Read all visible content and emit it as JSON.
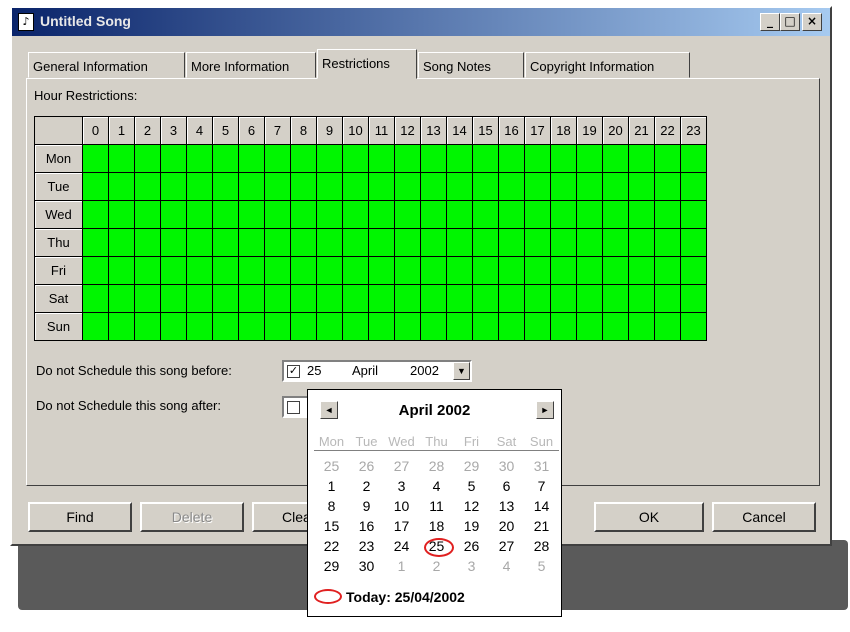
{
  "window": {
    "title": "Untitled Song",
    "controls": {
      "minimize": "_",
      "maximize": "□",
      "close": "×"
    }
  },
  "tabs": [
    {
      "label": "General Information"
    },
    {
      "label": "More Information"
    },
    {
      "label": "Restrictions",
      "active": true
    },
    {
      "label": "Song Notes"
    },
    {
      "label": "Copyright Information"
    }
  ],
  "restrictions": {
    "hour_label": "Hour Restrictions:",
    "hours": [
      "0",
      "1",
      "2",
      "3",
      "4",
      "5",
      "6",
      "7",
      "8",
      "9",
      "10",
      "11",
      "12",
      "13",
      "14",
      "15",
      "16",
      "17",
      "18",
      "19",
      "20",
      "21",
      "22",
      "23"
    ],
    "days": [
      "Mon",
      "Tue",
      "Wed",
      "Thu",
      "Fri",
      "Sat",
      "Sun"
    ],
    "allowed_color": "#00f600",
    "before_label": "Do not Schedule this song before:",
    "before_checked": true,
    "before_day": "25",
    "before_month": "April",
    "before_year": "2002",
    "after_label": "Do not Schedule this song after:",
    "after_checked": false
  },
  "calendar": {
    "month_title": "April 2002",
    "weekdays": [
      "Mon",
      "Tue",
      "Wed",
      "Thu",
      "Fri",
      "Sat",
      "Sun"
    ],
    "days": [
      {
        "d": "25",
        "other": true
      },
      {
        "d": "26",
        "other": true
      },
      {
        "d": "27",
        "other": true
      },
      {
        "d": "28",
        "other": true
      },
      {
        "d": "29",
        "other": true
      },
      {
        "d": "30",
        "other": true
      },
      {
        "d": "31",
        "other": true
      },
      {
        "d": "1"
      },
      {
        "d": "2"
      },
      {
        "d": "3"
      },
      {
        "d": "4"
      },
      {
        "d": "5"
      },
      {
        "d": "6"
      },
      {
        "d": "7"
      },
      {
        "d": "8"
      },
      {
        "d": "9"
      },
      {
        "d": "10"
      },
      {
        "d": "11"
      },
      {
        "d": "12"
      },
      {
        "d": "13"
      },
      {
        "d": "14"
      },
      {
        "d": "15"
      },
      {
        "d": "16"
      },
      {
        "d": "17"
      },
      {
        "d": "18"
      },
      {
        "d": "19"
      },
      {
        "d": "20"
      },
      {
        "d": "21"
      },
      {
        "d": "22"
      },
      {
        "d": "23"
      },
      {
        "d": "24"
      },
      {
        "d": "25",
        "today": true
      },
      {
        "d": "26"
      },
      {
        "d": "27"
      },
      {
        "d": "28"
      },
      {
        "d": "29"
      },
      {
        "d": "30"
      },
      {
        "d": "1",
        "other": true
      },
      {
        "d": "2",
        "other": true
      },
      {
        "d": "3",
        "other": true
      },
      {
        "d": "4",
        "other": true
      },
      {
        "d": "5",
        "other": true
      }
    ],
    "today_text": "Today: 25/04/2002",
    "prev_icon": "◄",
    "next_icon": "►"
  },
  "buttons": {
    "find": "Find",
    "delete": "Delete",
    "clear": "Clea",
    "ok": "OK",
    "cancel": "Cancel"
  }
}
